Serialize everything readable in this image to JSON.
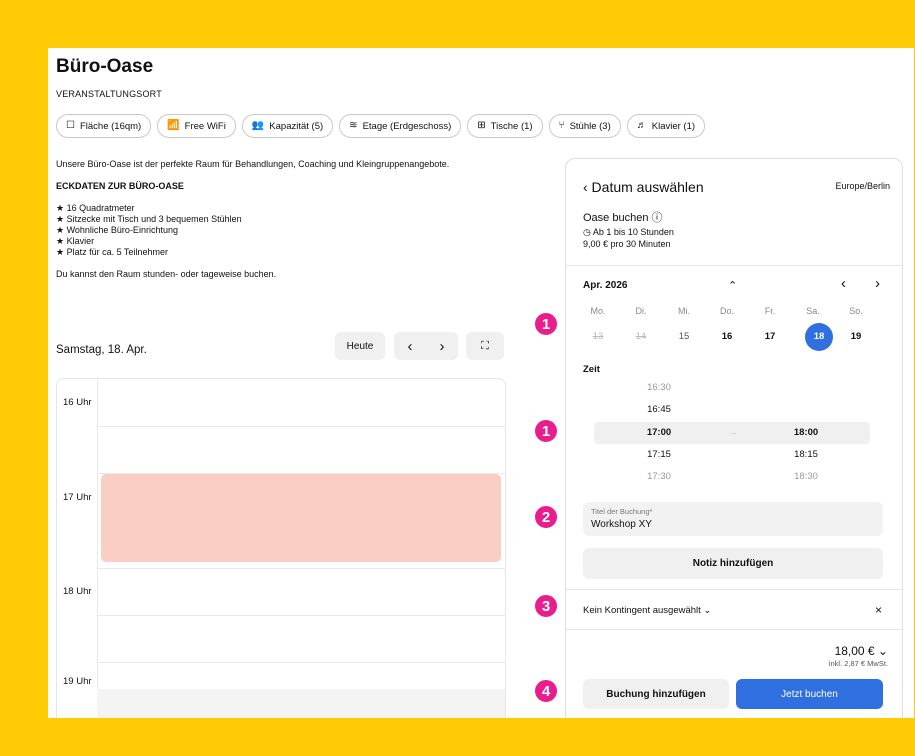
{
  "header": {
    "title": "Büro-Oase",
    "subtitle": "VERANSTALTUNGSORT"
  },
  "chips": [
    {
      "icon": "square-icon",
      "glyph": "☐",
      "label": "Fläche (16qm)"
    },
    {
      "icon": "wifi-icon",
      "glyph": "📶",
      "label": "Free WiFi"
    },
    {
      "icon": "people-icon",
      "glyph": "👥",
      "label": "Kapazität (5)"
    },
    {
      "icon": "layers-icon",
      "glyph": "≋",
      "label": "Etage (Erdgeschoss)"
    },
    {
      "icon": "table-icon",
      "glyph": "⊞",
      "label": "Tische (1)"
    },
    {
      "icon": "chair-icon",
      "glyph": "⑂",
      "label": "Stühle (3)"
    },
    {
      "icon": "piano-icon",
      "glyph": "♬",
      "label": "Klavier (1)"
    }
  ],
  "description": {
    "intro": "Unsere Büro-Oase ist der perfekte Raum für Behandlungen, Coaching und Kleingruppenangebote.",
    "heading": "ECKDATEN ZUR BÜRO-OASE",
    "facts": [
      "★ 16 Quadratmeter",
      "★ Sitzecke mit Tisch und 3 bequemen Stühlen",
      "★ Wohnliche Büro-Einrichtung",
      "★ Klavier",
      "★ Platz für ca. 5 Teilnehmer"
    ],
    "footer": "Du kannst den Raum stunden- oder tageweise buchen."
  },
  "calendar": {
    "date_label": "Samstag, 18. Apr.",
    "today_label": "Heute",
    "prev": "‹",
    "next": "›",
    "expand": "⛶",
    "hours": [
      "16 Uhr",
      "17 Uhr",
      "18 Uhr",
      "19 Uhr"
    ]
  },
  "booking": {
    "title": "‹ Datum auswählen",
    "timezone": "Europe/Berlin",
    "product": "Oase buchen ⓘ",
    "duration": "◷ Ab 1 bis 10 Stunden",
    "price_rate": "9,00 € pro 30 Minuten",
    "month": "Apr. 2026",
    "month_toggle": "⌃",
    "nav_prev": "‹",
    "nav_next": "›",
    "weekdays": [
      "Mo.",
      "Di.",
      "Mi.",
      "Do.",
      "Fr.",
      "Sa.",
      "So."
    ],
    "days": [
      "13",
      "14",
      "15",
      "16",
      "17",
      "18",
      "19"
    ],
    "selected_day": "18",
    "zeit_label": "Zeit",
    "start_times": [
      "16:30",
      "16:45",
      "17:00",
      "17:15",
      "17:30"
    ],
    "end_times": [
      "18:00",
      "18:15",
      "18:30"
    ],
    "arrow": "→",
    "field_label": "Titel der Buchung*",
    "field_value": "Workshop XY",
    "note_button": "Notiz hinzufügen",
    "quota": "Kein Kontingent ausgewählt ⌄",
    "quota_close": "×",
    "total": "18,00 € ⌄",
    "vat": "inkl. 2,87 € MwSt.",
    "add_button": "Buchung hinzufügen",
    "book_button": "Jetzt buchen",
    "accent": "#2F6FE0"
  },
  "badges": [
    "1",
    "1",
    "2",
    "3",
    "4"
  ]
}
